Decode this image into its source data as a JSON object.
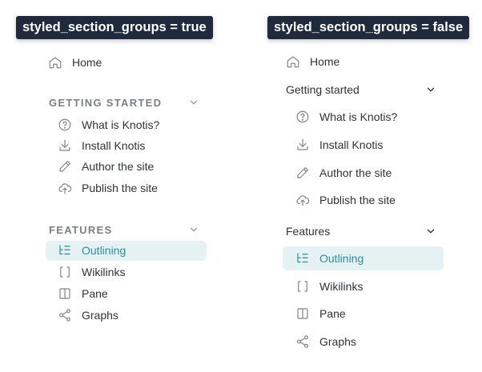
{
  "captions": {
    "left": "styled_section_groups = true",
    "right": "styled_section_groups = false"
  },
  "nav": {
    "home": "Home",
    "sections": [
      {
        "title": "Getting started",
        "title_styled": "GETTING STARTED",
        "items": [
          {
            "label": "What is Knotis?",
            "icon": "question-circle-icon"
          },
          {
            "label": "Install Knotis",
            "icon": "download-icon"
          },
          {
            "label": "Author the site",
            "icon": "pencil-icon"
          },
          {
            "label": "Publish the site",
            "icon": "cloud-upload-icon"
          }
        ]
      },
      {
        "title": "Features",
        "title_styled": "FEATURES",
        "items": [
          {
            "label": "Outlining",
            "icon": "outline-list-icon",
            "active": true
          },
          {
            "label": "Wikilinks",
            "icon": "brackets-icon"
          },
          {
            "label": "Pane",
            "icon": "pane-icon"
          },
          {
            "label": "Graphs",
            "icon": "share-graph-icon"
          }
        ]
      }
    ]
  },
  "colors": {
    "caption_bg": "#1f2a3d",
    "active_bg": "#e5f1f2",
    "active_text": "#2a8f9a",
    "muted_icon": "#7f8589"
  }
}
